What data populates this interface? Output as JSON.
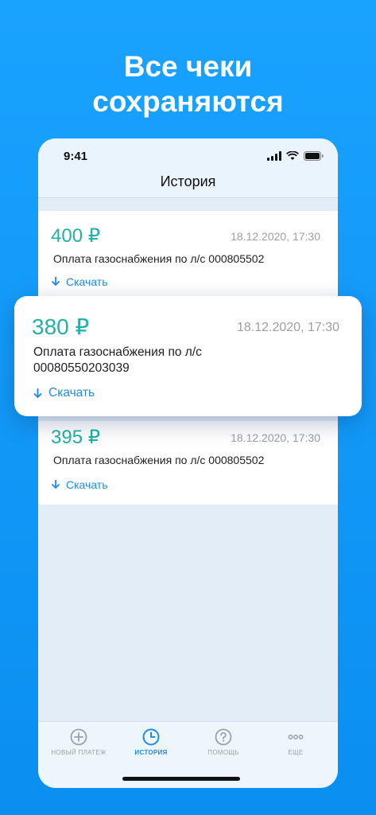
{
  "headline": {
    "line1": "Все чеки",
    "line2": "сохраняются"
  },
  "status_bar": {
    "time": "9:41"
  },
  "nav": {
    "title": "История"
  },
  "receipts": [
    {
      "amount": "400 ₽",
      "date": "18.12.2020, 17:30",
      "description": "Оплата газоснабжения по л/с 000805502",
      "action": "Скачать"
    },
    {
      "amount": "380 ₽",
      "date": "18.12.2020, 17:30",
      "description": "Оплата газоснабжения по л/с 00080550203039",
      "action": "Скачать"
    },
    {
      "amount": "395 ₽",
      "date": "18.12.2020, 17:30",
      "description": "Оплата газоснабжения по л/с 000805502",
      "action": "Скачать"
    }
  ],
  "tabs": [
    {
      "label": "НОВЫЙ ПЛАТЕЖ",
      "icon": "plus-circle-icon"
    },
    {
      "label": "ИСТОРИЯ",
      "icon": "clock-icon",
      "active": true
    },
    {
      "label": "ПОМОЩЬ",
      "icon": "question-circle-icon"
    },
    {
      "label": "ЕЩЕ",
      "icon": "more-dots-icon"
    }
  ],
  "colors": {
    "background": "#1aa2ff",
    "amount": "#22b1a4",
    "accent": "#1b8cf0"
  }
}
